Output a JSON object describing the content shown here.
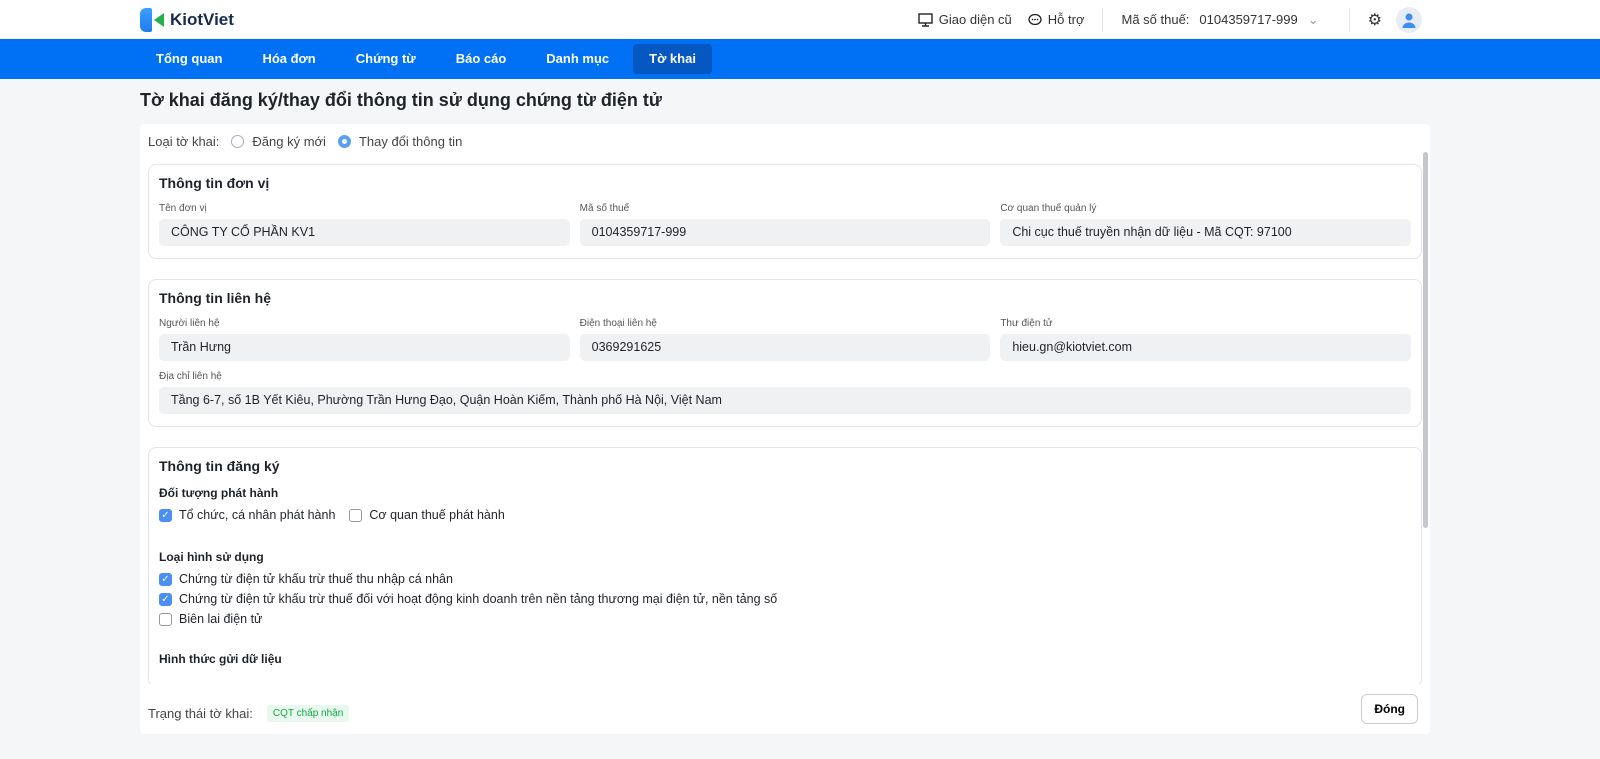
{
  "header": {
    "brand": "KiotViet",
    "old_ui": "Giao diện cũ",
    "support": "Hỗ trợ",
    "tax_label": "Mã số thuế:",
    "tax_value": "0104359717-999"
  },
  "nav": [
    "Tổng quan",
    "Hóa đơn",
    "Chứng từ",
    "Báo cáo",
    "Danh mục",
    "Tờ khai"
  ],
  "page_title": "Tờ khai đăng ký/thay đổi thông tin sử dụng chứng từ điện tử",
  "declaration_type": {
    "label": "Loại tờ khai:",
    "options": [
      "Đăng ký mới",
      "Thay đổi thông tin"
    ],
    "selected": "Thay đổi thông tin"
  },
  "unit": {
    "title": "Thông tin đơn vị",
    "name_label": "Tên đơn vị",
    "name": "CÔNG TY CỔ PHẦN KV1",
    "tax_label": "Mã số thuế",
    "tax": "0104359717-999",
    "agency_label": "Cơ quan thuế quản lý",
    "agency": "Chi cục thuế truyền nhận dữ liệu - Mã CQT: 97100"
  },
  "contact": {
    "title": "Thông tin liên hệ",
    "person_label": "Người liên hệ",
    "person": "Trần Hưng",
    "phone_label": "Điện thoại liên hệ",
    "phone": "0369291625",
    "email_label": "Thư điện tử",
    "email": "hieu.gn@kiotviet.com",
    "address_label": "Địa chỉ liên hệ",
    "address": "Tầng 6-7, số 1B Yết Kiêu, Phường Trần Hưng Đạo, Quận Hoàn Kiếm, Thành phố Hà Nội, Việt Nam"
  },
  "registration": {
    "title": "Thông tin đăng ký",
    "issuer_title": "Đối tượng phát hành",
    "issuers": [
      {
        "label": "Tổ chức, cá nhân phát hành",
        "checked": true
      },
      {
        "label": "Cơ quan thuế phát hành",
        "checked": false
      }
    ],
    "usage_title": "Loại hình sử dụng",
    "usages": [
      {
        "label": "Chứng từ điện tử khấu trừ thuế thu nhập cá nhân",
        "checked": true
      },
      {
        "label": "Chứng từ điện tử khấu trừ thuế đối với hoạt động kinh doanh trên nền tảng thương mại điện tử, nền tảng số",
        "checked": true
      },
      {
        "label": "Biên lai điện tử",
        "checked": false
      }
    ],
    "send_title": "Hình thức gửi dữ liệu"
  },
  "footer": {
    "status_label": "Trạng thái tờ khai:",
    "status": "CQT chấp nhận",
    "close": "Đóng"
  }
}
